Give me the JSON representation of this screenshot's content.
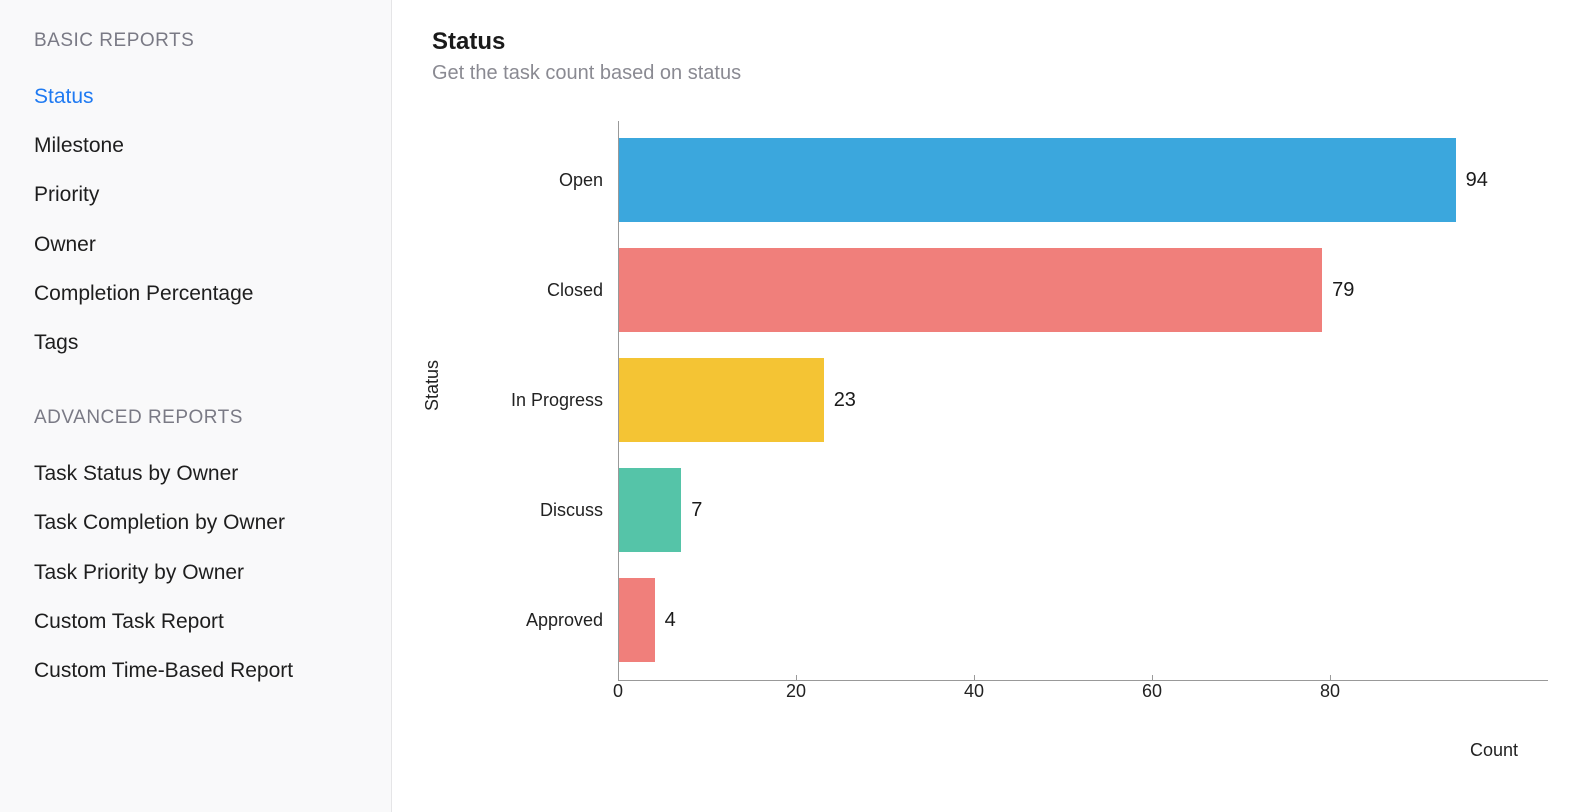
{
  "sidebar": {
    "sections": [
      {
        "header": "BASIC REPORTS",
        "items": [
          {
            "label": "Status",
            "active": true
          },
          {
            "label": "Milestone",
            "active": false
          },
          {
            "label": "Priority",
            "active": false
          },
          {
            "label": "Owner",
            "active": false
          },
          {
            "label": "Completion Percentage",
            "active": false
          },
          {
            "label": "Tags",
            "active": false
          }
        ]
      },
      {
        "header": "ADVANCED REPORTS",
        "items": [
          {
            "label": "Task Status by Owner",
            "active": false
          },
          {
            "label": "Task Completion by Owner",
            "active": false
          },
          {
            "label": "Task Priority by Owner",
            "active": false
          },
          {
            "label": "Custom Task Report",
            "active": false
          },
          {
            "label": "Custom Time-Based Report",
            "active": false
          }
        ]
      }
    ]
  },
  "page": {
    "title": "Status",
    "subtitle": "Get the task count based on status"
  },
  "chart_data": {
    "type": "bar",
    "orientation": "horizontal",
    "title": "Status",
    "xlabel": "Count",
    "ylabel": "Status",
    "xlim": [
      0,
      100
    ],
    "xticks": [
      0,
      20,
      40,
      60,
      80
    ],
    "categories": [
      "Open",
      "Closed",
      "In Progress",
      "Discuss",
      "Approved"
    ],
    "values": [
      94,
      79,
      23,
      7,
      4
    ],
    "colors": [
      "#3ba7dd",
      "#f07f7b",
      "#f4c434",
      "#55c4a8",
      "#f07f7b"
    ]
  }
}
